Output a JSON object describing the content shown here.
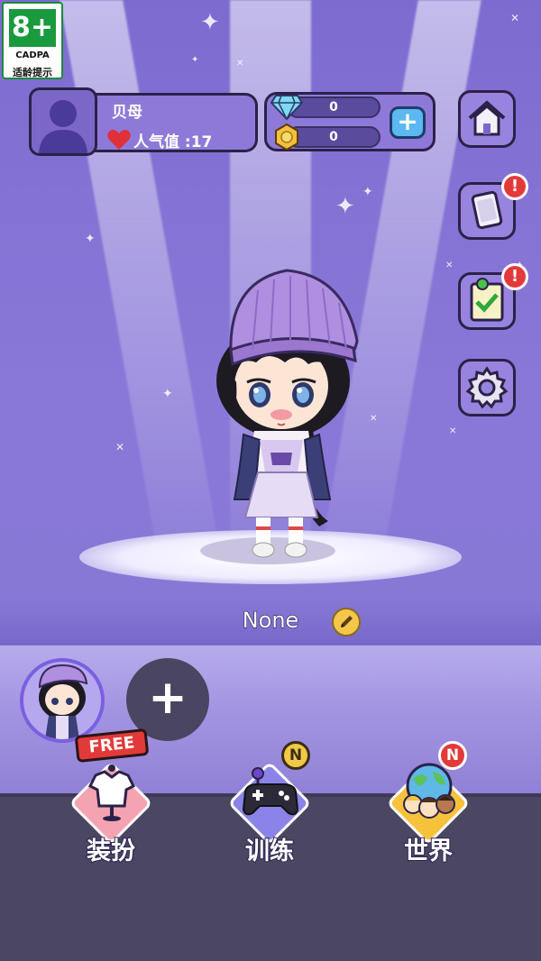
{
  "age_rating": {
    "label": "8+",
    "org": "CADPA",
    "note": "适龄提示"
  },
  "profile": {
    "name": "贝母",
    "popularity_label": "人气值",
    "popularity_value": ":17"
  },
  "currency": {
    "gems": "0",
    "coins": "0",
    "add_label": "+"
  },
  "side_buttons": {
    "home": "home-icon",
    "cards_alert": "!",
    "tasks_alert": "!",
    "settings": "gear-icon"
  },
  "character": {
    "name": "None"
  },
  "slots": {
    "add_label": "+"
  },
  "nav": {
    "dress": {
      "label": "装扮",
      "tag": "FREE"
    },
    "train": {
      "label": "训练",
      "badge": "N"
    },
    "world": {
      "label": "世界",
      "badge": "N"
    }
  },
  "colors": {
    "accent": "#7a66c9",
    "panel": "#8f79d8",
    "alert": "#e23a3a",
    "coin": "#f4c64a"
  }
}
